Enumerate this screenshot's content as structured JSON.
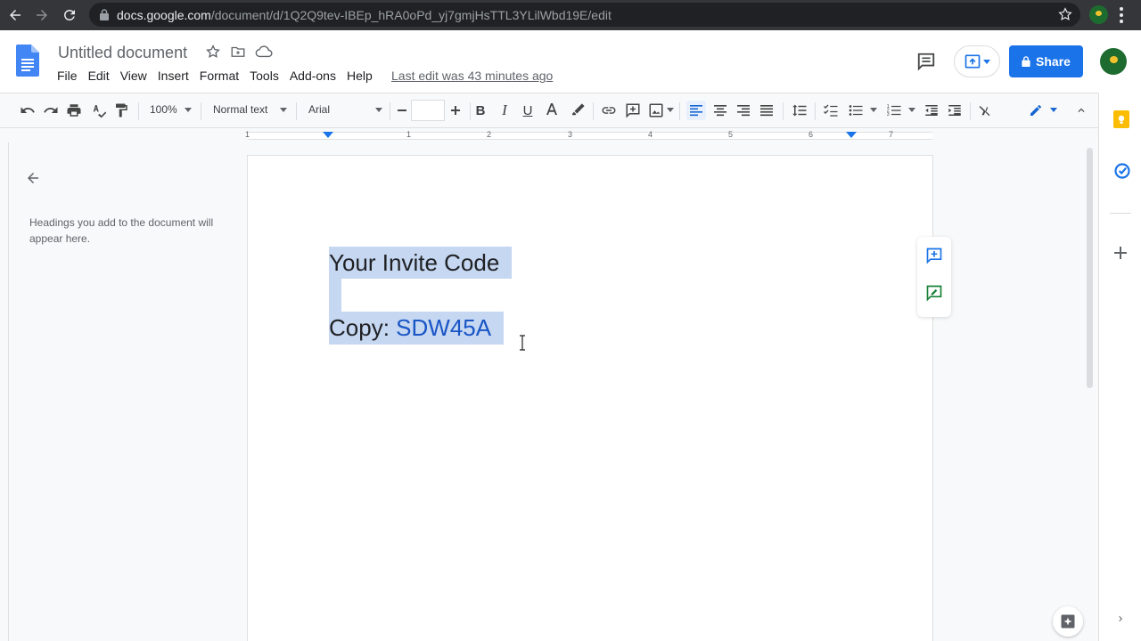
{
  "browser": {
    "url_domain": "docs.google.com",
    "url_path": "/document/d/1Q2Q9tev-IBEp_hRA0oPd_yj7gmjHsTTL3YLilWbd19E/edit"
  },
  "header": {
    "doc_title": "Untitled document",
    "menus": [
      "File",
      "Edit",
      "View",
      "Insert",
      "Format",
      "Tools",
      "Add-ons",
      "Help"
    ],
    "last_edit": "Last edit was 43 minutes ago",
    "share_label": "Share"
  },
  "toolbar": {
    "zoom": "100%",
    "style": "Normal text",
    "font": "Arial",
    "font_size": ""
  },
  "ruler": {
    "numbers": [
      "1",
      "1",
      "2",
      "3",
      "4",
      "5",
      "6",
      "7"
    ]
  },
  "outline": {
    "hint": "Headings you add to the document will appear here."
  },
  "document": {
    "line1": "Your Invite Code",
    "line3_prefix": "Copy: ",
    "line3_code": "SDW45A"
  },
  "colors": {
    "accent": "#1a73e8",
    "selection": "#c5d7f1",
    "code_text": "#1a55c6"
  }
}
